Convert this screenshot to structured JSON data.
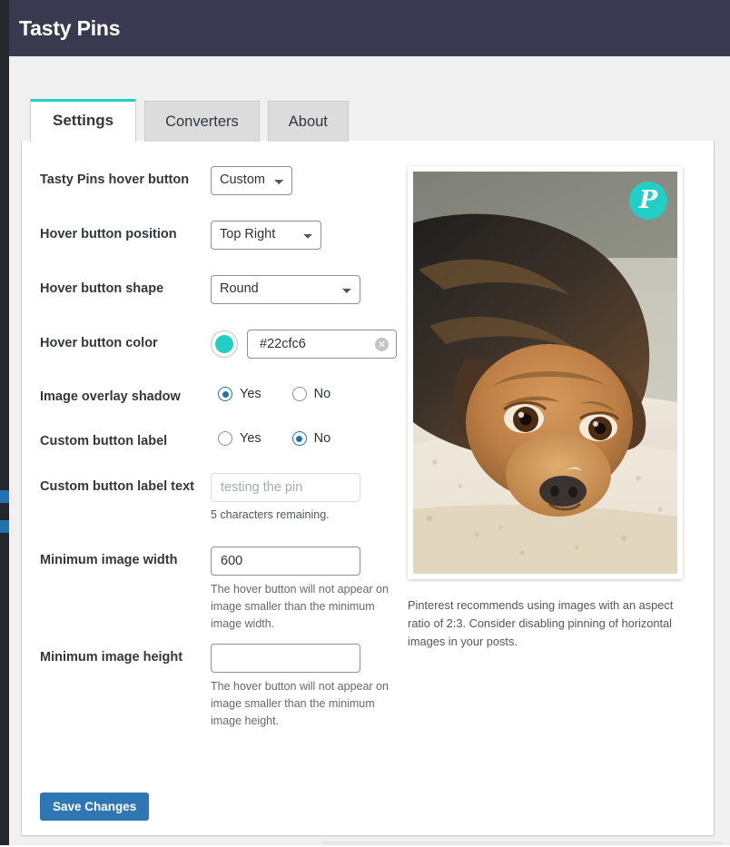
{
  "header": {
    "title": "Tasty Pins"
  },
  "theme": {
    "header_bg": "#393a4f",
    "accent_teal": "#21cfc6",
    "link_blue": "#2271b1",
    "save_blue": "#2e76b4",
    "page_bg": "#f0f0f0",
    "rail_dark": "#23282d"
  },
  "tabs": [
    {
      "label": "Settings",
      "active": true
    },
    {
      "label": "Converters",
      "active": false
    },
    {
      "label": "About",
      "active": false
    }
  ],
  "settings": {
    "hover_button": {
      "label": "Tasty Pins hover button",
      "value": "Custom",
      "options": [
        "Custom"
      ]
    },
    "hover_position": {
      "label": "Hover button position",
      "value": "Top Right",
      "options": [
        "Top Right"
      ]
    },
    "hover_shape": {
      "label": "Hover button shape",
      "value": "Round",
      "options": [
        "Round"
      ]
    },
    "hover_color": {
      "label": "Hover button color",
      "value": "#22cfc6",
      "swatch": "#22cfc6",
      "clear_icon": "clear-circle-icon",
      "clear_glyph": "✕"
    },
    "overlay_shadow": {
      "label": "Image overlay shadow",
      "options": [
        {
          "label": "Yes",
          "selected": true
        },
        {
          "label": "No",
          "selected": false
        }
      ]
    },
    "custom_button_label": {
      "label": "Custom button label",
      "options": [
        {
          "label": "Yes",
          "selected": false
        },
        {
          "label": "No",
          "selected": true
        }
      ]
    },
    "custom_button_label_text": {
      "label": "Custom button label text",
      "value": "",
      "placeholder": "testing the pin",
      "char_count": "5 characters remaining."
    },
    "minimum_image_width": {
      "label": "Minimum image width",
      "value": "600",
      "help": "The hover button will not appear on image smaller than the minimum image width."
    },
    "minimum_image_height": {
      "label": "Minimum image height",
      "value": "",
      "help": "The hover button will not appear on image smaller than the minimum image height."
    },
    "save_label": "Save Changes"
  },
  "preview": {
    "image_alt": "Brown and black dog lying on a white textured rug",
    "pin_button": {
      "icon": "pinterest-icon",
      "glyph": "P",
      "background": "#22cfc6"
    },
    "note": "Pinterest recommends using images with an aspect ratio of 2:3. Consider disabling pinning of horizontal images in your posts."
  }
}
